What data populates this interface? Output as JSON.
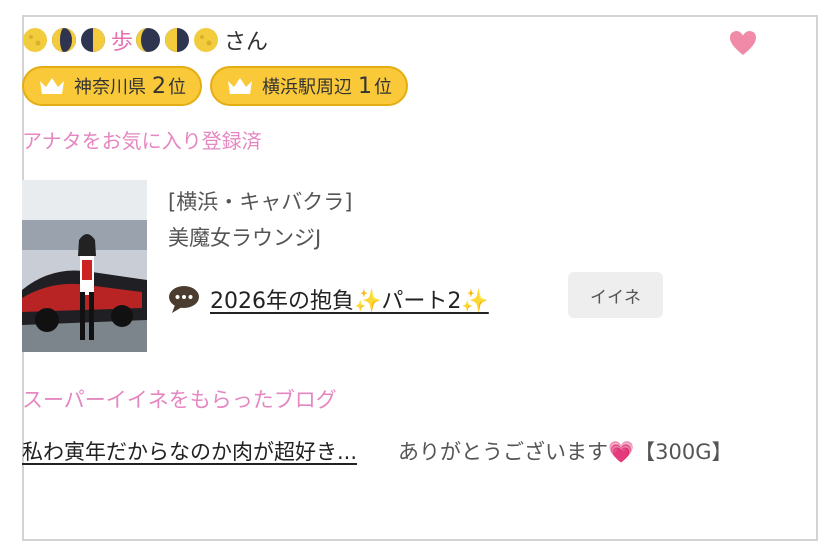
{
  "user": {
    "name_mid": "歩",
    "name_suffix": "さん",
    "moon_icons": [
      "full-moon-icon",
      "gibbous-moon-icon",
      "half-moon-icon",
      "crescent-moon-icon",
      "half-moon-icon",
      "full-moon-icon"
    ]
  },
  "ranks": [
    {
      "area": "神奈川県",
      "rank": "2",
      "suffix": "位"
    },
    {
      "area": "横浜駅周辺",
      "rank": "1",
      "suffix": "位"
    }
  ],
  "favorite_status": "アナタをお気に入り登録済",
  "post": {
    "category": "[横浜・キャバクラ]",
    "shop_name": "美魔女ラウンジJ",
    "blog_title": "2026年の抱負✨パート2✨",
    "like_button": "イイネ"
  },
  "super_like": {
    "heading": "スーパーイイネをもらったブログ",
    "link_text": "私わ寅年だからなのか肉が超好き...",
    "message": "ありがとうございます💗【300G】"
  },
  "colors": {
    "accent_pink": "#e587c1",
    "badge_yellow": "#f9c93a",
    "heart": "#f08aa8"
  }
}
